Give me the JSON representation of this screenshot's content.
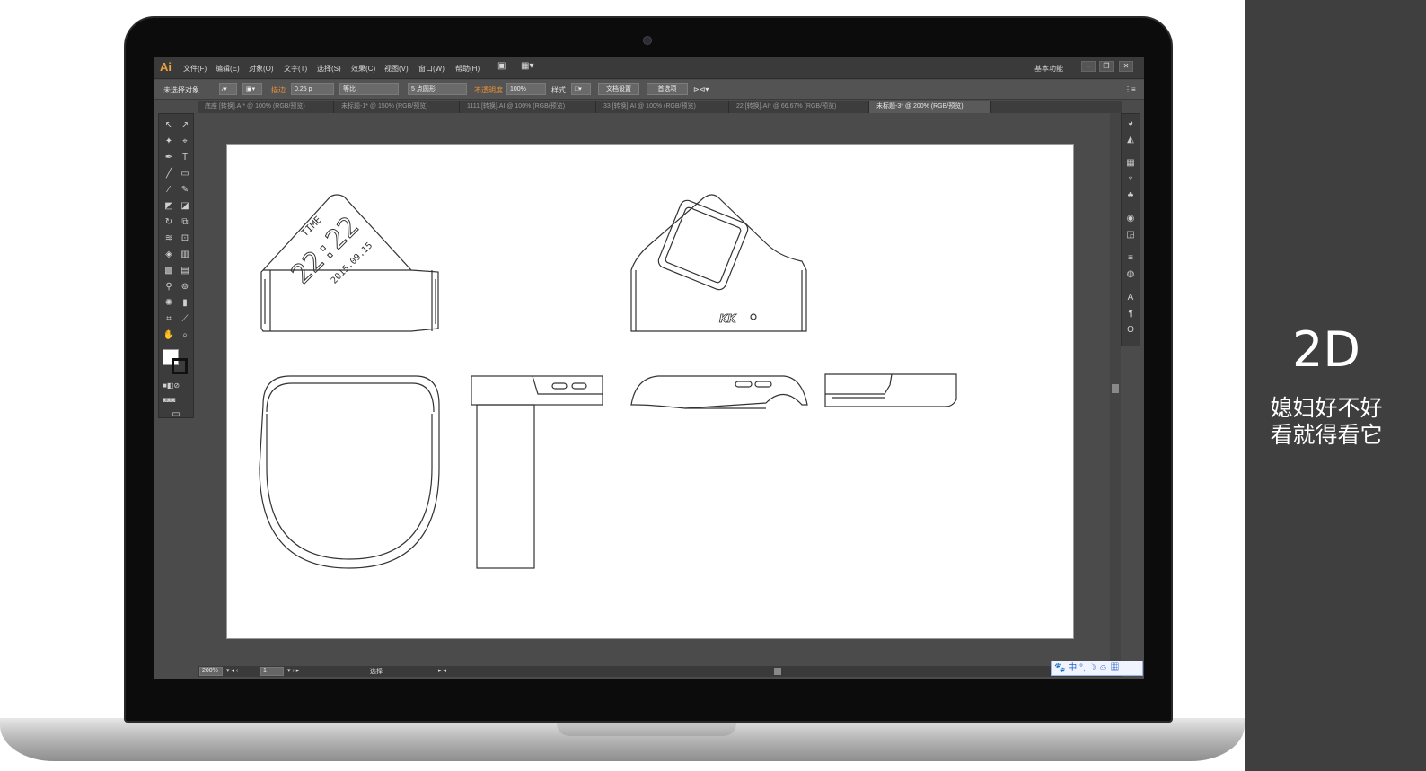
{
  "side": {
    "title": "2D",
    "line1": "媳妇好不好",
    "line2": "看就得看它"
  },
  "app": {
    "logo": "Ai",
    "menus": [
      "文件(F)",
      "编辑(E)",
      "对象(O)",
      "文字(T)",
      "选择(S)",
      "效果(C)",
      "视图(V)",
      "窗口(W)",
      "帮助(H)"
    ],
    "workspace": "基本功能"
  },
  "control": {
    "selection": "未选择对象",
    "stroke_label": "描边",
    "stroke_value": "0.25 p",
    "profile": "等比",
    "brush": "5 点圆形",
    "opacity_label": "不透明度",
    "opacity_value": "100%",
    "style_label": "样式",
    "doc_setup": "文档设置",
    "prefs": "首选项"
  },
  "tabs": [
    "底座 [转换].AI* @ 100% (RGB/预览)",
    "未标题-1* @ 150% (RGB/预览)",
    "1111 [转换].AI @ 100% (RGB/预览)",
    "33 [转换].AI @ 100% (RGB/预览)",
    "22 [转换].AI* @ 66.67% (RGB/预览)",
    "未标题-3* @ 200% (RGB/预览)"
  ],
  "watch": {
    "time_label": "TIME",
    "time": "22:22",
    "date": "2015.09.15",
    "brand": "KK"
  },
  "status": {
    "zoom": "200%",
    "page": "1",
    "mode": "选择"
  },
  "ime": {
    "text": "中"
  },
  "colors": {
    "panel": "#3f3f3f",
    "ui_dark": "#3a3a3a",
    "ui_mid": "#535353",
    "accent": "#e8a33c"
  }
}
